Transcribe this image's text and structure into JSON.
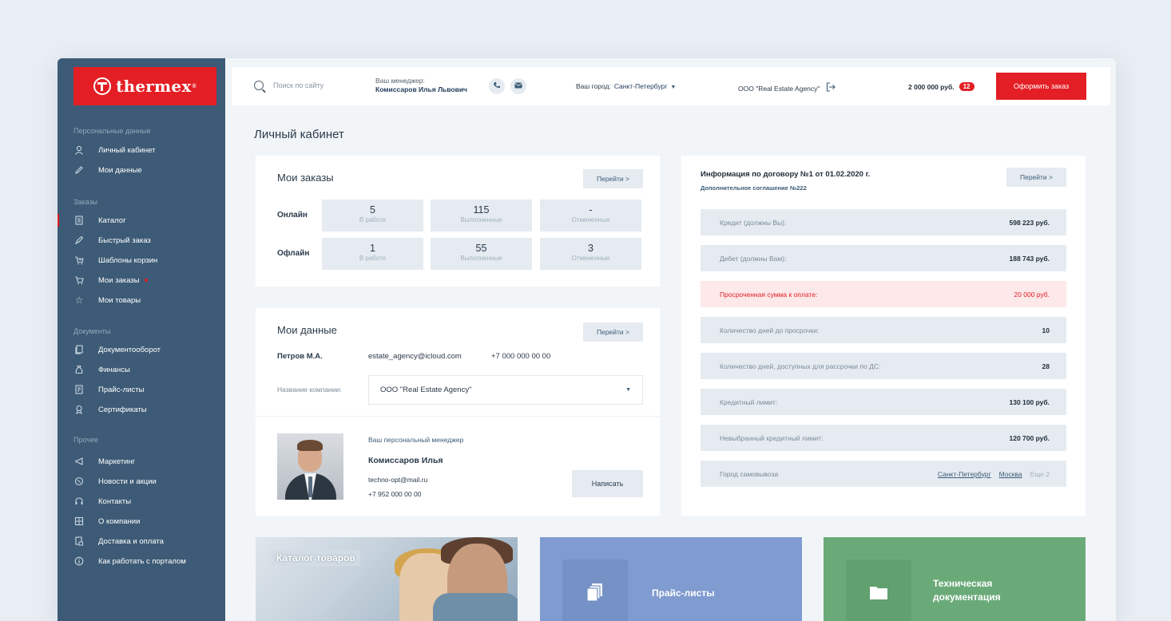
{
  "brand": {
    "name": "thermex",
    "tm": "®"
  },
  "sidebar": {
    "sections": [
      {
        "title": "Персональные данные",
        "items": [
          {
            "label": "Личный кабинет",
            "icon": "user-icon"
          },
          {
            "label": "Мои данные",
            "icon": "pencil-icon"
          }
        ]
      },
      {
        "title": "Заказы",
        "items": [
          {
            "label": "Каталог",
            "icon": "catalog-icon"
          },
          {
            "label": "Быстрый заказ",
            "icon": "rocket-icon"
          },
          {
            "label": "Шаблоны корзин",
            "icon": "cart-template-icon"
          },
          {
            "label": "Мои заказы",
            "icon": "cart-icon"
          },
          {
            "label": "Мои товары",
            "icon": "star-icon"
          }
        ]
      },
      {
        "title": "Документы",
        "items": [
          {
            "label": "Документооборот",
            "icon": "documents-icon"
          },
          {
            "label": "Финансы",
            "icon": "finance-icon"
          },
          {
            "label": "Прайс-листы",
            "icon": "price-list-icon"
          },
          {
            "label": "Сертификаты",
            "icon": "certificate-icon"
          }
        ]
      },
      {
        "title": "Прочее",
        "items": [
          {
            "label": "Маркетинг",
            "icon": "megaphone-icon"
          },
          {
            "label": "Новости и акции",
            "icon": "news-icon"
          },
          {
            "label": "Контакты",
            "icon": "headset-icon"
          },
          {
            "label": "О компании",
            "icon": "building-icon"
          },
          {
            "label": "Доставка и оплата",
            "icon": "delivery-icon"
          },
          {
            "label": "Как работать с порталом",
            "icon": "info-icon"
          }
        ]
      }
    ]
  },
  "topbar": {
    "search_placeholder": "Поиск по сайту",
    "manager_label": "Ваш менеджер:",
    "manager_name": "Комиссаров Илья Львович",
    "city_label": "Ваш город:",
    "city_value": "Санкт-Петербург",
    "company": "ООО \"Real Estate Agency\"",
    "cart_sum": "2 000 000 руб.",
    "cart_count": "12",
    "order_button": "Оформить заказ"
  },
  "page_title": "Личный кабинет",
  "orders": {
    "title": "Мои заказы",
    "go": "Перейти >",
    "rows": [
      {
        "label": "Онлайн",
        "cells": [
          {
            "num": "5",
            "sub": "В работе"
          },
          {
            "num": "115",
            "sub": "Выполненные"
          },
          {
            "num": "-",
            "sub": "Отмененные"
          }
        ]
      },
      {
        "label": "Офлайн",
        "cells": [
          {
            "num": "1",
            "sub": "В работе"
          },
          {
            "num": "55",
            "sub": "Выполненные"
          },
          {
            "num": "3",
            "sub": "Отмененные"
          }
        ]
      }
    ]
  },
  "mydata": {
    "title": "Мои данные",
    "go": "Перейти >",
    "name": "Петров М.А.",
    "email": "estate_agency@icloud.com",
    "phone": "+7 000 000 00 00",
    "company_label": "Название компании:",
    "company_value": "ООО \"Real Estate Agency\"",
    "manager_caption": "Ваш персональный менеджер",
    "manager_name": "Комиссаров Илья",
    "manager_email": "techno-opt@mail.ru",
    "manager_phone": "+7 952 000 00 00",
    "write_button": "Написать"
  },
  "contract": {
    "title": "Информация по договору №1 от 01.02.2020 г.",
    "subtitle": "Дополнительное соглашение №222",
    "go": "Перейти >",
    "rows": [
      {
        "label": "Кредит (должны Вы):",
        "value": "598 223 руб."
      },
      {
        "label": "Дебет (должны Вам):",
        "value": "188 743 руб."
      },
      {
        "label": "Просроченная сумма к оплате:",
        "value": "20 000 руб."
      },
      {
        "label": "Количество дней до просрочки:",
        "value": "10"
      },
      {
        "label": "Количество дней, доступных для рассрочки по ДС:",
        "value": "28"
      },
      {
        "label": "Кредитный лимит:",
        "value": "130 100 руб."
      },
      {
        "label": "Невыбранный кредитный лимит:",
        "value": "120 700 руб."
      }
    ],
    "pickup_label": "Город самовывоза",
    "pickup_city1": "Санкт-Петербург",
    "pickup_city2": "Москва",
    "pickup_more": "Еще 2"
  },
  "tiles": {
    "catalog": "Каталог товаров",
    "prices": "Прайс-листы",
    "tech_line1": "Техническая",
    "tech_line2": "документация"
  },
  "colors": {
    "accent": "#e31e24",
    "sidebar": "#3d5b76",
    "prices_tile": "#7f9bd0",
    "tech_tile": "#6aaa78"
  }
}
